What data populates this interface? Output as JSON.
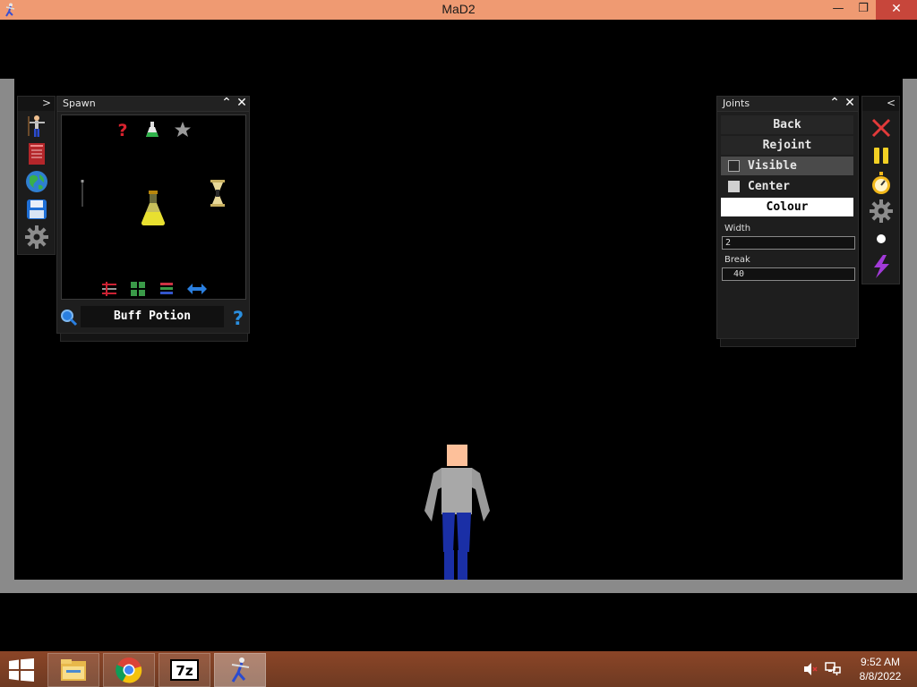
{
  "window": {
    "title": "MaD2",
    "minimize_symbol": "—",
    "maximize_symbol": "❐",
    "close_symbol": "✕"
  },
  "left_toolbar": {
    "collapse_symbol": ">",
    "tools": [
      "ragdoll-icon",
      "book-icon",
      "globe-icon",
      "save-disk-icon",
      "gear-icon"
    ]
  },
  "spawn_panel": {
    "title": "Spawn",
    "top_icons": [
      "question-mark-icon",
      "flask-icon",
      "star-icon"
    ],
    "items": [
      "needle-item",
      "potion-item",
      "hourglass-item"
    ],
    "bottom_icons": [
      "swap-icon",
      "grid-icon",
      "stack-icon",
      "left-right-arrow-icon"
    ],
    "selected_item": "Buff Potion",
    "search_icon": "magnifier-icon",
    "help_icon": "question-mark-icon"
  },
  "joints_panel": {
    "title": "Joints",
    "back_label": "Back",
    "rejoint_label": "Rejoint",
    "visible_label": "Visible",
    "visible_checked": false,
    "center_label": "Center",
    "center_checked": true,
    "colour_label": "Colour",
    "width_label": "Width",
    "width_value": "2",
    "break_label": "Break",
    "break_value": "40"
  },
  "right_toolbar": {
    "collapse_symbol": "<",
    "tools": [
      "delete-x-icon",
      "pause-icon",
      "stopwatch-icon",
      "gear-icon",
      "dot-icon",
      "lightning-icon"
    ]
  },
  "taskbar": {
    "apps": [
      "file-explorer-icon",
      "chrome-icon",
      "7zip-icon",
      "mad2-icon"
    ],
    "time": "9:52 AM",
    "date": "8/8/2022"
  },
  "colors": {
    "titlebar": "#ef9a72",
    "close_button": "#c7463b",
    "game_border": "#8a8a8a",
    "panel_bg": "#1e1e1e",
    "taskbar": "#7a3f25"
  }
}
